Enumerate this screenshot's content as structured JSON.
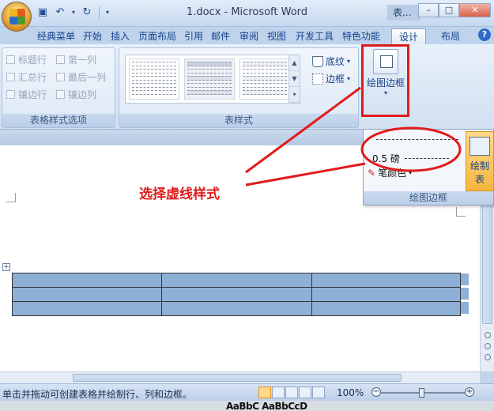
{
  "window": {
    "title": "1.docx - Microsoft Word",
    "context_tab_label": "表...",
    "controls": [
      "–",
      "□",
      "✕"
    ]
  },
  "tabs": [
    {
      "label": "经典菜单"
    },
    {
      "label": "开始"
    },
    {
      "label": "插入"
    },
    {
      "label": "页面布局"
    },
    {
      "label": "引用"
    },
    {
      "label": "邮件"
    },
    {
      "label": "审阅"
    },
    {
      "label": "视图"
    },
    {
      "label": "开发工具"
    },
    {
      "label": "特色功能"
    },
    {
      "label": "设计",
      "active": true
    },
    {
      "label": "布局"
    }
  ],
  "ribbon": {
    "style_options": {
      "label": "表格样式选项",
      "checkboxes": [
        "标题行",
        "第一列",
        "汇总行",
        "最后一列",
        "镶边行",
        "镶边列"
      ]
    },
    "table_styles": {
      "label": "表样式",
      "shading_label": "底纹",
      "borders_label": "边框"
    },
    "draw_borders_button": "绘图边框"
  },
  "dropdown": {
    "weight_label": "0.5 磅",
    "pen_color_label": "笔颜色",
    "draw_table_label": "绘制表",
    "group_label": "绘图边框"
  },
  "annotation": "选择虚线样式",
  "status": {
    "text": "单击并拖动可创建表格并绘制行、列和边框。",
    "zoom": "100%"
  },
  "taskbar_text": "AaBbC AaBbCcD",
  "colors": {
    "highlight_red": "#e11b1b",
    "table_fill": "#8fb0d6",
    "ribbon_bg": "#dde8f6"
  }
}
